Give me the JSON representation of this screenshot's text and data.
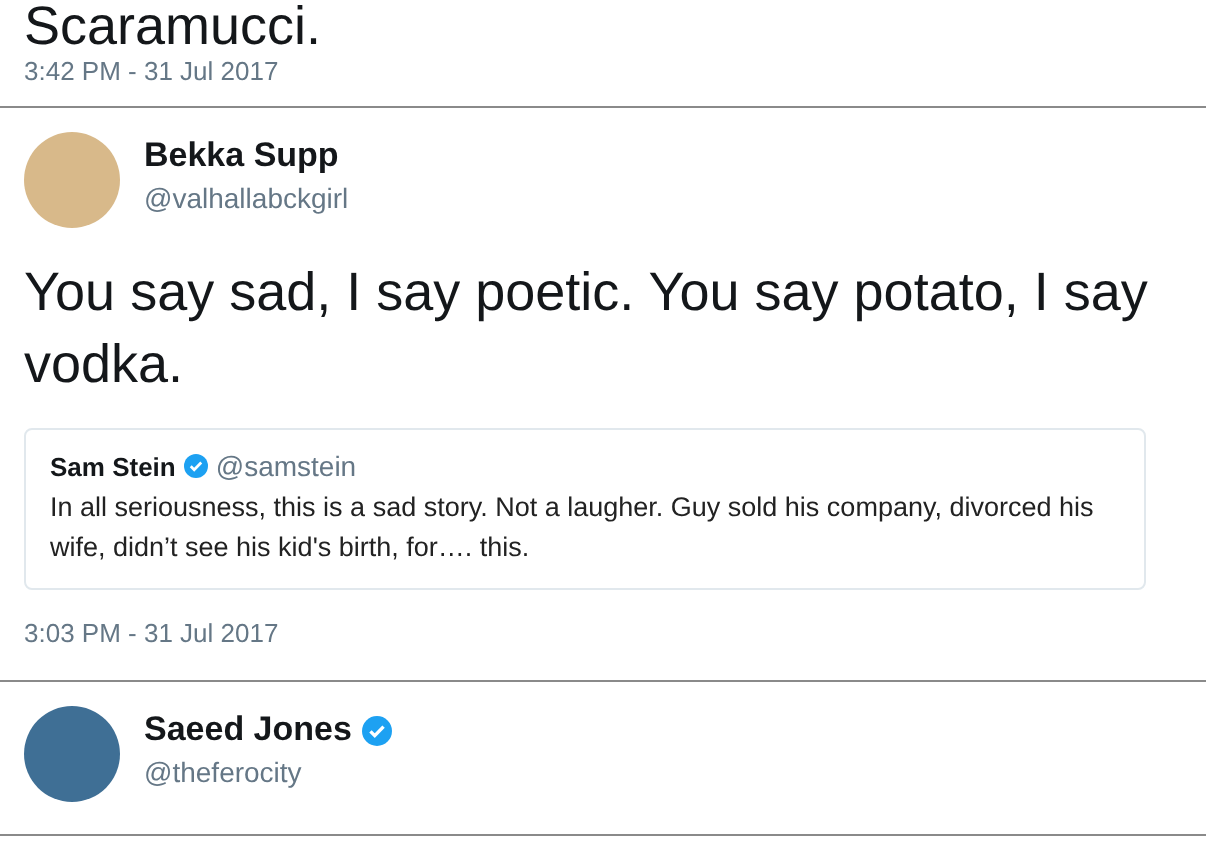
{
  "previous_tweet": {
    "text": "Scaramucci.",
    "timestamp": "3:42 PM - 31 Jul 2017"
  },
  "tweets": [
    {
      "author": {
        "name": "Bekka Supp",
        "handle": "@valhallabckgirl",
        "verified": false
      },
      "text": "You say sad, I say poetic. You say potato, I say vodka.",
      "quoted_tweet": {
        "author": {
          "name": "Sam Stein",
          "handle": "@samstein",
          "verified": true
        },
        "text": "In all seriousness, this is a sad story. Not a laugher. Guy sold his company, divorced his wife, didn’t see his kid's birth, for…. this."
      },
      "timestamp": "3:03 PM - 31 Jul 2017"
    },
    {
      "author": {
        "name": "Saeed Jones",
        "handle": "@theferocity",
        "verified": true
      }
    }
  ]
}
